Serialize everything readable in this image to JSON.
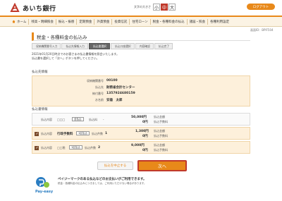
{
  "header": {
    "bank_name": "あいち銀行",
    "fontsize_label": "文字の大きさ",
    "fontsize_options": [
      "小",
      "中",
      "大"
    ],
    "logout_label": "ログアウト"
  },
  "nav": {
    "items": [
      "ホーム",
      "残高・明細照会",
      "振込・振替",
      "定期預金",
      "外貨預金",
      "投資信託",
      "住宅ローン",
      "税金・各種料金の払込",
      "諸届・照会",
      "各種利用設定"
    ]
  },
  "screen_id": "画面ID：BPIF504",
  "page_title": "税金・各種料金の払込み",
  "steps": [
    "収納機関番号入力",
    "払込先情報入力",
    "払込書選択",
    "払込口座選択",
    "内容確認",
    "払込完了"
  ],
  "notes": [
    "2021年01月20日時点でのお客さまの払込書情報を照会いたします。",
    "払込書を選択して「次へ」ボタンを押してください。"
  ],
  "payee": {
    "section_label": "払込先情報",
    "rows": [
      {
        "key": "収納機関番号",
        "value": "00100"
      },
      {
        "key": "払込先",
        "value": "財務省会計センター"
      },
      {
        "key": "納付番号",
        "value": "1357924680159"
      },
      {
        "key": "お名前",
        "value": "安雄　太郎"
      }
    ]
  },
  "bills": {
    "section_label": "払込書情報",
    "rows": [
      {
        "label_content": "払込内容",
        "content": "□□□",
        "tag": "全払込",
        "label_amount": "払込金額",
        "amount_label2": "払込料",
        "amount": "50,000円",
        "fee_label": "払込金額",
        "fee": "0円",
        "fee_label2": "払込手数料",
        "count_prefix": "-"
      },
      {
        "label_content": "払込内容",
        "content": "行政手数料",
        "tag": "1区払込",
        "label_amount": "払込件数",
        "count": "1",
        "amount": "1,300円",
        "fee_label": "払込金額",
        "fee": "0円",
        "fee_label2": "払込手数料"
      },
      {
        "label_content": "払込内容",
        "content": "□□税",
        "tag": "1区払込",
        "label_amount": "払込件数",
        "count": "2",
        "amount": "9,000円",
        "fee_label": "払込金額",
        "fee": "0円",
        "fee_label2": "払込手数料"
      }
    ]
  },
  "buttons": {
    "cancel": "払込を中止する",
    "next": "次へ"
  },
  "payeasy": {
    "logo_text": "Pay-easy",
    "message": "ペイジーマークのある払込などのお支払いがご利用できます。",
    "sub": "税金・各種料金の払込みにつきましては、ご利用いただけない場合があります。"
  },
  "colors": {
    "accent": "#e8891a",
    "brand_red": "#c0392b",
    "selected_bg": "#fdf0db"
  }
}
